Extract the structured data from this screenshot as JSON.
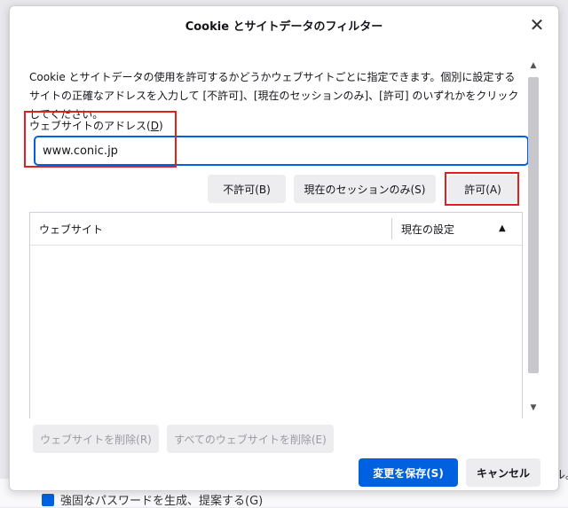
{
  "background": {
    "checkbox_text": "強固なパスワードを生成、提案する(G)",
    "right_fragment": "ル。"
  },
  "dialog": {
    "title": "Cookie とサイトデータのフィルター",
    "close_symbol": "✕",
    "description": "Cookie とサイトデータの使用を許可するかどうかウェブサイトごとに指定できます。個別に設定するサイトの正確なアドレスを入力して [不許可]、[現在のセッションのみ]、[許可] のいずれかをクリックしてください。",
    "address_label": "ウェブサイトのアドレス",
    "address_label_key": "D",
    "address_value": "www.conic.jp",
    "buttons": {
      "block": "不許可(B)",
      "session": "現在のセッションのみ(S)",
      "allow": "許可(A)"
    },
    "list": {
      "col_website": "ウェブサイト",
      "col_status": "現在の設定",
      "sort_symbol": "▲",
      "rows": []
    },
    "footer": {
      "remove": "ウェブサイトを削除(R)",
      "remove_all": "すべてのウェブサイトを削除(E)",
      "save": "変更を保存(S)",
      "cancel": "キャンセル"
    }
  },
  "colors": {
    "accent": "#0061e0",
    "highlight": "#e0201f"
  }
}
